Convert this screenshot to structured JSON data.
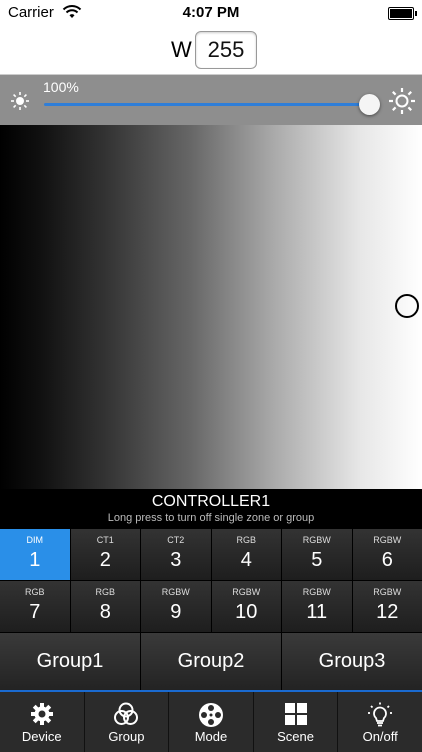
{
  "status": {
    "carrier": "Carrier",
    "time": "4:07 PM"
  },
  "white": {
    "label": "W",
    "value": "255"
  },
  "brightness": {
    "percent_label": "100%",
    "level": 1.0
  },
  "controller": {
    "name": "CONTROLLER1",
    "hint": "Long press to turn off single zone or group"
  },
  "zones": [
    {
      "type": "DIM",
      "num": "1"
    },
    {
      "type": "CT1",
      "num": "2"
    },
    {
      "type": "CT2",
      "num": "3"
    },
    {
      "type": "RGB",
      "num": "4"
    },
    {
      "type": "RGBW",
      "num": "5"
    },
    {
      "type": "RGBW",
      "num": "6"
    },
    {
      "type": "RGB",
      "num": "7"
    },
    {
      "type": "RGB",
      "num": "8"
    },
    {
      "type": "RGBW",
      "num": "9"
    },
    {
      "type": "RGBW",
      "num": "10"
    },
    {
      "type": "RGBW",
      "num": "11"
    },
    {
      "type": "RGBW",
      "num": "12"
    }
  ],
  "groups": [
    "Group1",
    "Group2",
    "Group3"
  ],
  "tabs": [
    {
      "label": "Device",
      "icon": "gear-icon"
    },
    {
      "label": "Group",
      "icon": "circles-icon"
    },
    {
      "label": "Mode",
      "icon": "film-reel-icon"
    },
    {
      "label": "Scene",
      "icon": "grid-icon"
    },
    {
      "label": "On/off",
      "icon": "bulb-icon"
    }
  ],
  "colors": {
    "accent": "#2a8fe8",
    "slider": "#2f7ed8"
  }
}
